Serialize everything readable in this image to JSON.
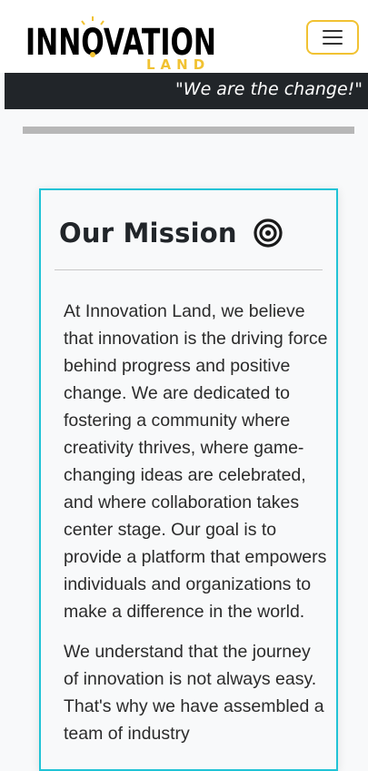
{
  "header": {
    "logo": {
      "text_main": "INNOVATION",
      "text_sub": "LAND"
    },
    "menu_button_icon": "hamburger-icon"
  },
  "tagline": "\"We are the change!\"",
  "mission": {
    "title": "Our Mission",
    "icon": "target-icon",
    "paragraphs": [
      "At Innovation Land, we believe that innovation is the driving force behind progress and positive change. We are dedicated to fostering a community where creativity thrives, where game-changing ideas are celebrated, and where collaboration takes center stage. Our goal is to provide a platform that empowers individuals and organizations to make a difference in the world.",
      "We understand that the journey of innovation is not always easy. That's why we have assembled a team of industry"
    ]
  },
  "colors": {
    "accent_yellow": "#f1c232",
    "card_border": "#20c3d6",
    "tagline_bg": "#212529",
    "rule_gray": "#b7b7b7"
  }
}
